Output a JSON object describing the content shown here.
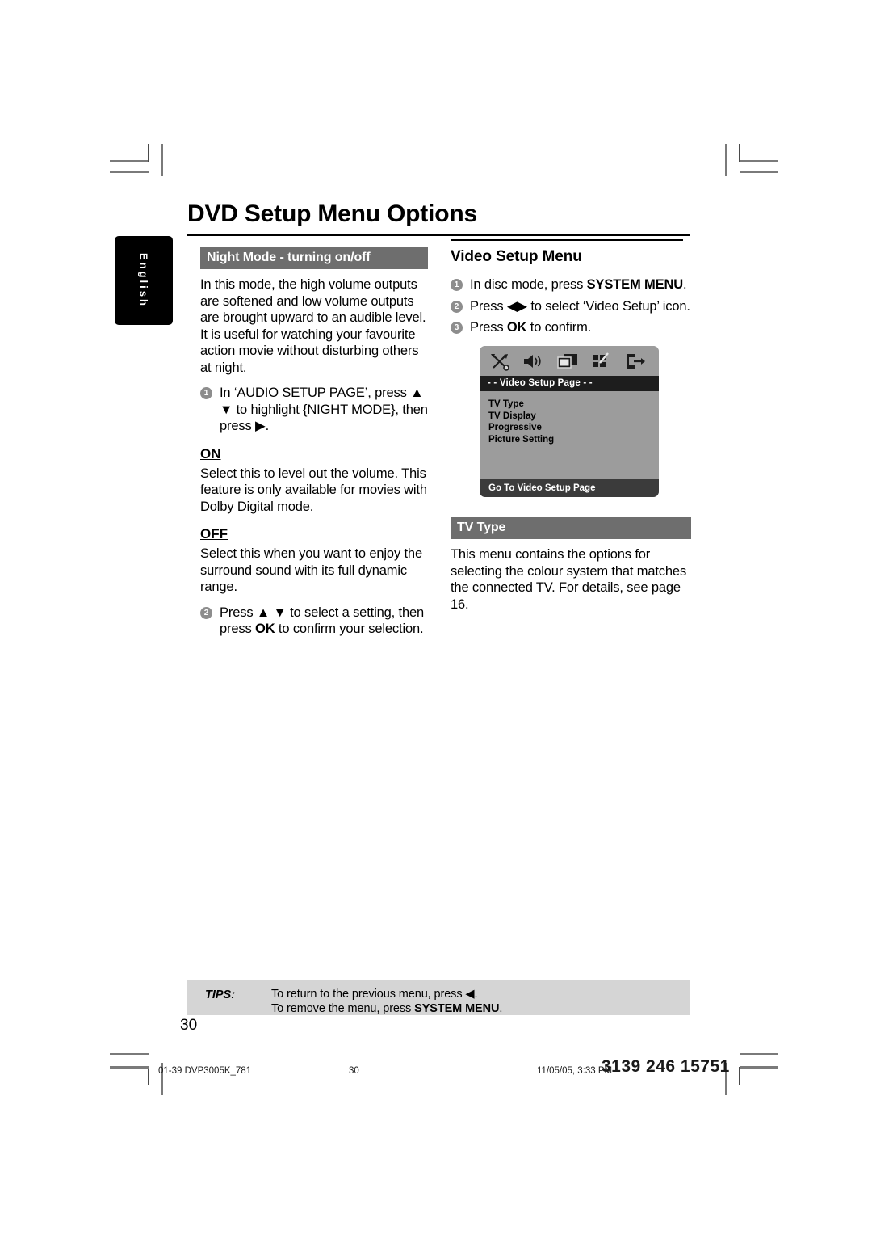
{
  "page": {
    "title": "DVD Setup Menu Options",
    "language_tab": "English",
    "page_number": "30"
  },
  "left_column": {
    "section_header": "Night Mode - turning on/off",
    "intro": "In this mode, the high volume outputs are softened and low volume outputs are brought upward to an audible level.  It is useful for watching your favourite action movie without disturbing others at night.",
    "steps": [
      {
        "num": "1",
        "text": "In ‘AUDIO SETUP PAGE’, press ▲ ▼ to highlight {NIGHT MODE}, then press ▶."
      }
    ],
    "options": [
      {
        "name": "ON",
        "description": "Select this to level out the volume.  This feature is only available for movies with Dolby Digital mode."
      },
      {
        "name": "OFF",
        "description": "Select this when you want to enjoy the surround sound with its full dynamic range."
      }
    ],
    "final_step": {
      "num": "2",
      "text_before": "Press ▲ ▼ to select a setting, then press ",
      "key": "OK",
      "text_after": " to confirm your selection."
    }
  },
  "right_column": {
    "video_setup_header": "Video Setup Menu",
    "steps": [
      {
        "num": "1",
        "before": "In disc mode, press ",
        "key": "SYSTEM MENU",
        "after": "."
      },
      {
        "num": "2",
        "before": "Press ◀▶ to select ‘Video Setup’ icon.",
        "key": "",
        "after": ""
      },
      {
        "num": "3",
        "before": "Press ",
        "key": "OK",
        "after": " to confirm."
      }
    ],
    "tv_type_header": "TV Type",
    "tv_type_body": "This menu contains the options for selecting the colour system that matches the connected TV.  For details, see page 16."
  },
  "osd": {
    "icons": [
      "tools-icon",
      "speaker-icon",
      "video-screens-icon",
      "preference-tiles-icon",
      "exit-arrow-icon"
    ],
    "title": "- -   Video Setup Page   - -",
    "menu_items": [
      "TV Type",
      "TV Display",
      "Progressive",
      "Picture Setting"
    ],
    "footer": "Go To Video Setup Page",
    "colors": {
      "background": "#9c9c9c",
      "titlebar": "#1d1d1d",
      "footerbar": "#3b3b3b"
    }
  },
  "tips": {
    "label": "TIPS:",
    "line1_before": "To return to the previous menu, press ◀.",
    "line2_before": "To remove the menu, press ",
    "line2_key": "SYSTEM MENU",
    "line2_after": "."
  },
  "footer": {
    "file": "01-39 DVP3005K_781",
    "page": "30",
    "date": "11/05/05, 3:33 PM",
    "code": "3139 246 15751"
  },
  "colors": {
    "section_bar": "#6e6e6e",
    "tips_bg": "#d5d5d5",
    "bullet": "#8d8d8d"
  }
}
